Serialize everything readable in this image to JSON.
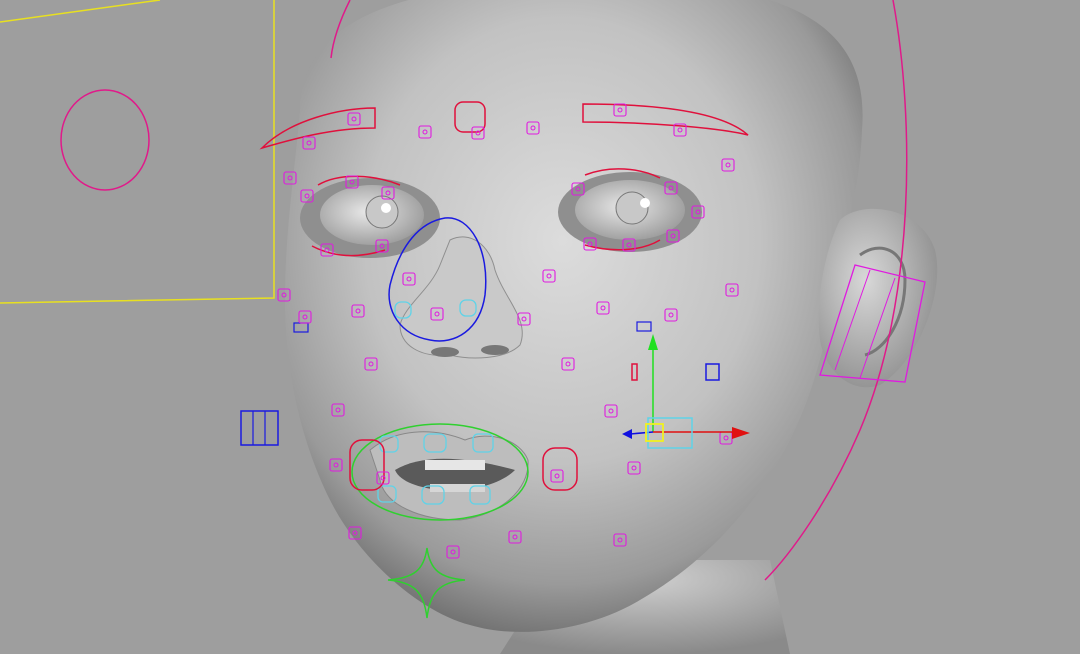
{
  "app": {
    "type": "3d-viewport",
    "panel": "perspective-viewport",
    "subject": "face-rig"
  },
  "viewport": {
    "background": "#9e9e9e"
  },
  "colors": {
    "skin_light": "#e4e4e4",
    "skin_mid": "#bdbdbd",
    "skin_dark": "#7d7d7d",
    "control_magenta": "#e01ae0",
    "control_red": "#e0103c",
    "control_blue": "#1a1ae0",
    "control_cyan": "#5fd3e8",
    "control_green": "#2fd02f",
    "frame_yellow": "#e8e020",
    "axis_x": "#e01010",
    "axis_y": "#20e020",
    "axis_z": "#1010e0",
    "pivot_yellow": "#f0f020"
  },
  "icons": {
    "manipulator": "move-manipulator-icon",
    "jaw_control": "four-point-star-icon",
    "facial_control": "square-joint-icon"
  },
  "selection": {
    "active_control": "right-cheek-control",
    "manipulator": "translate"
  }
}
